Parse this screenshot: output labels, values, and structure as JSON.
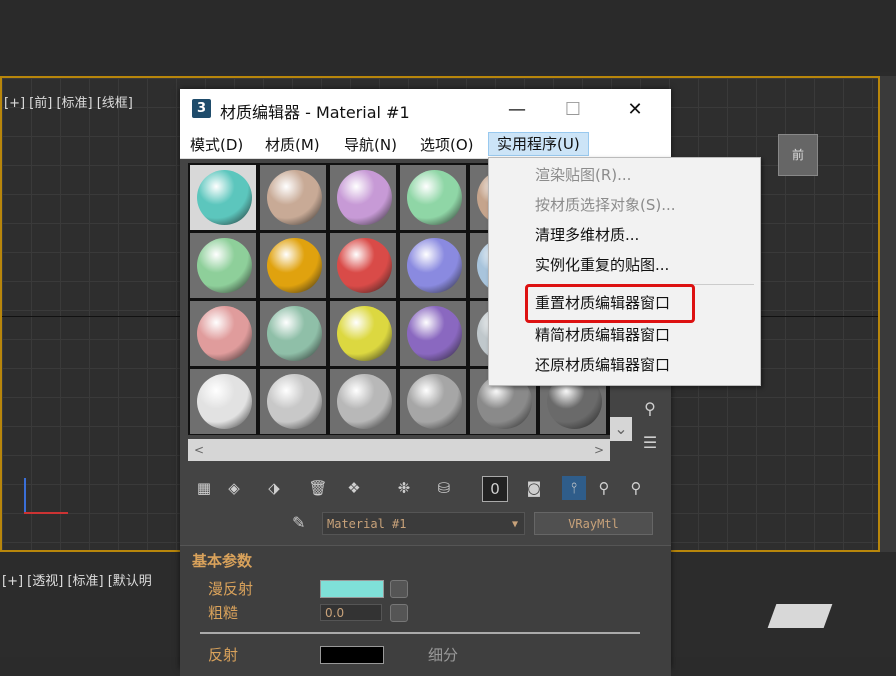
{
  "viewport_top": {
    "label": "[+] [前] [标准] [线框]"
  },
  "viewport_bottom": {
    "label": "[+] [透视] [标准] [默认明"
  },
  "viewcube": {
    "label": "前"
  },
  "window": {
    "icon_label": "3",
    "title": "材质编辑器 - Material #1",
    "minimize": "—",
    "maximize": "☐",
    "close": "✕"
  },
  "menubar": {
    "items": [
      "模式(D)",
      "材质(M)",
      "导航(N)",
      "选项(O)",
      "实用程序(U)"
    ]
  },
  "dropdown": {
    "items": [
      {
        "label": "渲染贴图(R)...",
        "enabled": false
      },
      {
        "label": "按材质选择对象(S)...",
        "enabled": false
      },
      {
        "label": "清理多维材质...",
        "enabled": true
      },
      {
        "label": "实例化重复的贴图...",
        "enabled": true
      },
      {
        "label": "重置材质编辑器窗口",
        "enabled": true
      },
      {
        "label": "精简材质编辑器窗口",
        "enabled": true
      },
      {
        "label": "还原材质编辑器窗口",
        "enabled": true
      }
    ]
  },
  "slots": [
    [
      "#5cc6bd",
      "#c8aa96",
      "#c79ad6",
      "#8fd6a6",
      "#c5a48c",
      null
    ],
    [
      "#8ecf9a",
      "#e0a20e",
      "#d94b48",
      "#8a8ae0",
      "#a8c4dc",
      null
    ],
    [
      "#e09c9c",
      "#8fbfa8",
      "#dcd840",
      "#8a68c0",
      "#c0c8cc",
      null
    ],
    [
      "#e2e2e2",
      "#c8c8c8",
      "#b8b8b8",
      "#a6a6a6",
      "#8a8a8a",
      "#6a6a6a"
    ]
  ],
  "material": {
    "name": "Material #1",
    "type": "VRayMtl"
  },
  "rollout": {
    "title": "基本参数",
    "diffuse_label": "漫反射",
    "roughness_label": "粗糙",
    "roughness_value": "0.0",
    "reflect_label": "反射",
    "subdiv_label": "细分",
    "diffuse_color": "#7fe0d8"
  },
  "colors": {
    "highlight": "#dd1111",
    "menu_active": "#cce4f7",
    "viewport_border": "#b8860b"
  }
}
